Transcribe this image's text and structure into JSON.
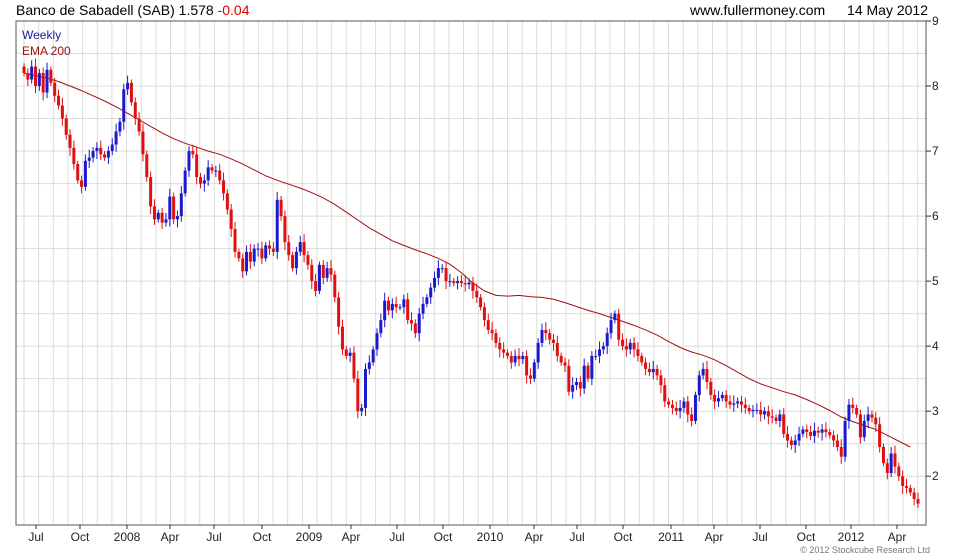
{
  "header": {
    "ticker": "Banco de Sabadell (SAB)",
    "price": "1.578",
    "change": "-0.04",
    "website": "www.fullermoney.com",
    "date": "14 May 2012"
  },
  "footer": "© 2012 Stockcube Research Ltd",
  "colors": {
    "up": "#1a1acc",
    "down": "#e01010",
    "ema": "#a01010",
    "grid": "#dcdcdc",
    "frame": "#555555",
    "legend_weekly": "#1a1a99",
    "legend_ema": "#a01010"
  },
  "chart_data": {
    "type": "line",
    "legend": [
      "Weekly",
      "EMA 200"
    ],
    "ylim": [
      1.25,
      9
    ],
    "y_ticks": [
      2,
      3,
      4,
      5,
      6,
      7,
      8,
      9
    ],
    "x_ticks": [
      "Jul",
      "Oct",
      "2008",
      "Apr",
      "Jul",
      "Oct",
      "2009",
      "Apr",
      "Jul",
      "Oct",
      "2010",
      "Apr",
      "Jul",
      "Oct",
      "2011",
      "Apr",
      "Jul",
      "Oct",
      "2012",
      "Apr"
    ],
    "legend_position": "top-left",
    "grid": true,
    "series": [
      {
        "name": "Weekly",
        "style": "candlestick",
        "close": [
          8.2,
          8.1,
          8.3,
          8.0,
          8.2,
          7.9,
          8.25,
          8.05,
          7.85,
          7.7,
          7.5,
          7.25,
          7.05,
          6.8,
          6.55,
          6.45,
          6.85,
          6.9,
          7.0,
          7.05,
          6.95,
          6.9,
          7.0,
          7.1,
          7.3,
          7.45,
          7.95,
          8.05,
          7.75,
          7.5,
          7.3,
          6.95,
          6.6,
          6.15,
          5.95,
          6.05,
          5.9,
          5.95,
          6.3,
          5.95,
          6.0,
          6.35,
          6.7,
          7.0,
          6.95,
          6.6,
          6.5,
          6.55,
          6.75,
          6.7,
          6.7,
          6.55,
          6.35,
          6.1,
          5.8,
          5.45,
          5.35,
          5.15,
          5.45,
          5.3,
          5.5,
          5.5,
          5.35,
          5.55,
          5.5,
          5.45,
          6.25,
          6.0,
          5.6,
          5.4,
          5.2,
          5.45,
          5.6,
          5.4,
          5.25,
          5.0,
          4.85,
          5.25,
          5.05,
          5.2,
          5.1,
          4.75,
          4.3,
          3.95,
          3.85,
          3.9,
          3.5,
          3.0,
          3.05,
          3.65,
          3.75,
          3.95,
          4.2,
          4.4,
          4.7,
          4.55,
          4.65,
          4.6,
          4.6,
          4.72,
          4.4,
          4.35,
          4.2,
          4.5,
          4.65,
          4.75,
          4.9,
          5.05,
          5.2,
          5.2,
          5.0,
          5.0,
          4.97,
          5.0,
          4.97,
          4.95,
          4.98,
          4.85,
          4.75,
          4.6,
          4.4,
          4.25,
          4.2,
          4.05,
          3.95,
          3.9,
          3.85,
          3.75,
          3.85,
          3.8,
          3.85,
          3.55,
          3.5,
          3.75,
          4.05,
          4.25,
          4.2,
          4.1,
          4.05,
          3.85,
          3.75,
          3.7,
          3.3,
          3.4,
          3.45,
          3.35,
          3.7,
          3.5,
          3.85,
          3.85,
          3.95,
          4.0,
          4.2,
          4.4,
          4.5,
          4.1,
          4.0,
          3.95,
          4.05,
          3.95,
          3.85,
          3.75,
          3.65,
          3.6,
          3.65,
          3.55,
          3.4,
          3.15,
          3.1,
          3.05,
          3.0,
          3.05,
          3.15,
          2.95,
          2.85,
          3.25,
          3.55,
          3.65,
          3.45,
          3.25,
          3.15,
          3.2,
          3.25,
          3.15,
          3.1,
          3.12,
          3.15,
          3.1,
          3.05,
          3.0,
          3.02,
          3.02,
          2.95,
          3.0,
          2.92,
          2.9,
          2.85,
          2.95,
          2.65,
          2.55,
          2.48,
          2.55,
          2.65,
          2.72,
          2.68,
          2.62,
          2.7,
          2.67,
          2.72,
          2.68,
          2.63,
          2.55,
          2.45,
          2.3,
          2.85,
          3.1,
          3.05,
          2.95,
          2.6,
          2.85,
          2.95,
          2.9,
          2.8,
          2.45,
          2.2,
          2.05,
          2.35,
          2.15,
          2.0,
          1.85,
          1.82,
          1.75,
          1.65,
          1.578
        ],
        "ema": [
          8.2,
          8.16,
          8.12,
          8.07,
          8.0,
          7.93,
          7.85,
          7.77,
          7.68,
          7.58,
          7.48,
          7.38,
          7.28,
          7.19,
          7.12,
          7.06,
          7.0,
          6.95,
          6.88,
          6.8,
          6.71,
          6.62,
          6.55,
          6.49,
          6.43,
          6.36,
          6.28,
          6.18,
          6.06,
          5.94,
          5.82,
          5.72,
          5.62,
          5.55,
          5.48,
          5.42,
          5.35,
          5.26,
          5.13,
          4.97,
          4.85,
          4.78,
          4.77,
          4.78,
          4.76,
          4.75,
          4.72,
          4.67,
          4.61,
          4.55,
          4.5,
          4.44,
          4.38,
          4.32,
          4.25,
          4.17,
          4.07,
          3.98,
          3.91,
          3.86,
          3.79,
          3.7,
          3.6,
          3.5,
          3.42,
          3.36,
          3.3,
          3.25,
          3.18,
          3.1,
          3.01,
          2.91,
          2.84,
          2.78,
          2.72,
          2.45
        ],
        "ema_weeks": [
          0,
          3,
          6,
          9,
          12,
          15,
          18,
          21,
          24,
          27,
          30,
          33,
          36,
          39,
          42,
          45,
          48,
          51,
          54,
          57,
          60,
          63,
          66,
          69,
          72,
          75,
          78,
          81,
          84,
          87,
          90,
          93,
          96,
          99,
          102,
          105,
          108,
          111,
          114,
          117,
          120,
          123,
          126,
          129,
          132,
          135,
          138,
          141,
          144,
          147,
          150,
          153,
          156,
          159,
          162,
          165,
          168,
          171,
          174,
          177,
          180,
          183,
          186,
          189,
          192,
          195,
          198,
          201,
          204,
          207,
          210,
          213,
          216,
          219,
          222,
          231
        ]
      }
    ]
  }
}
